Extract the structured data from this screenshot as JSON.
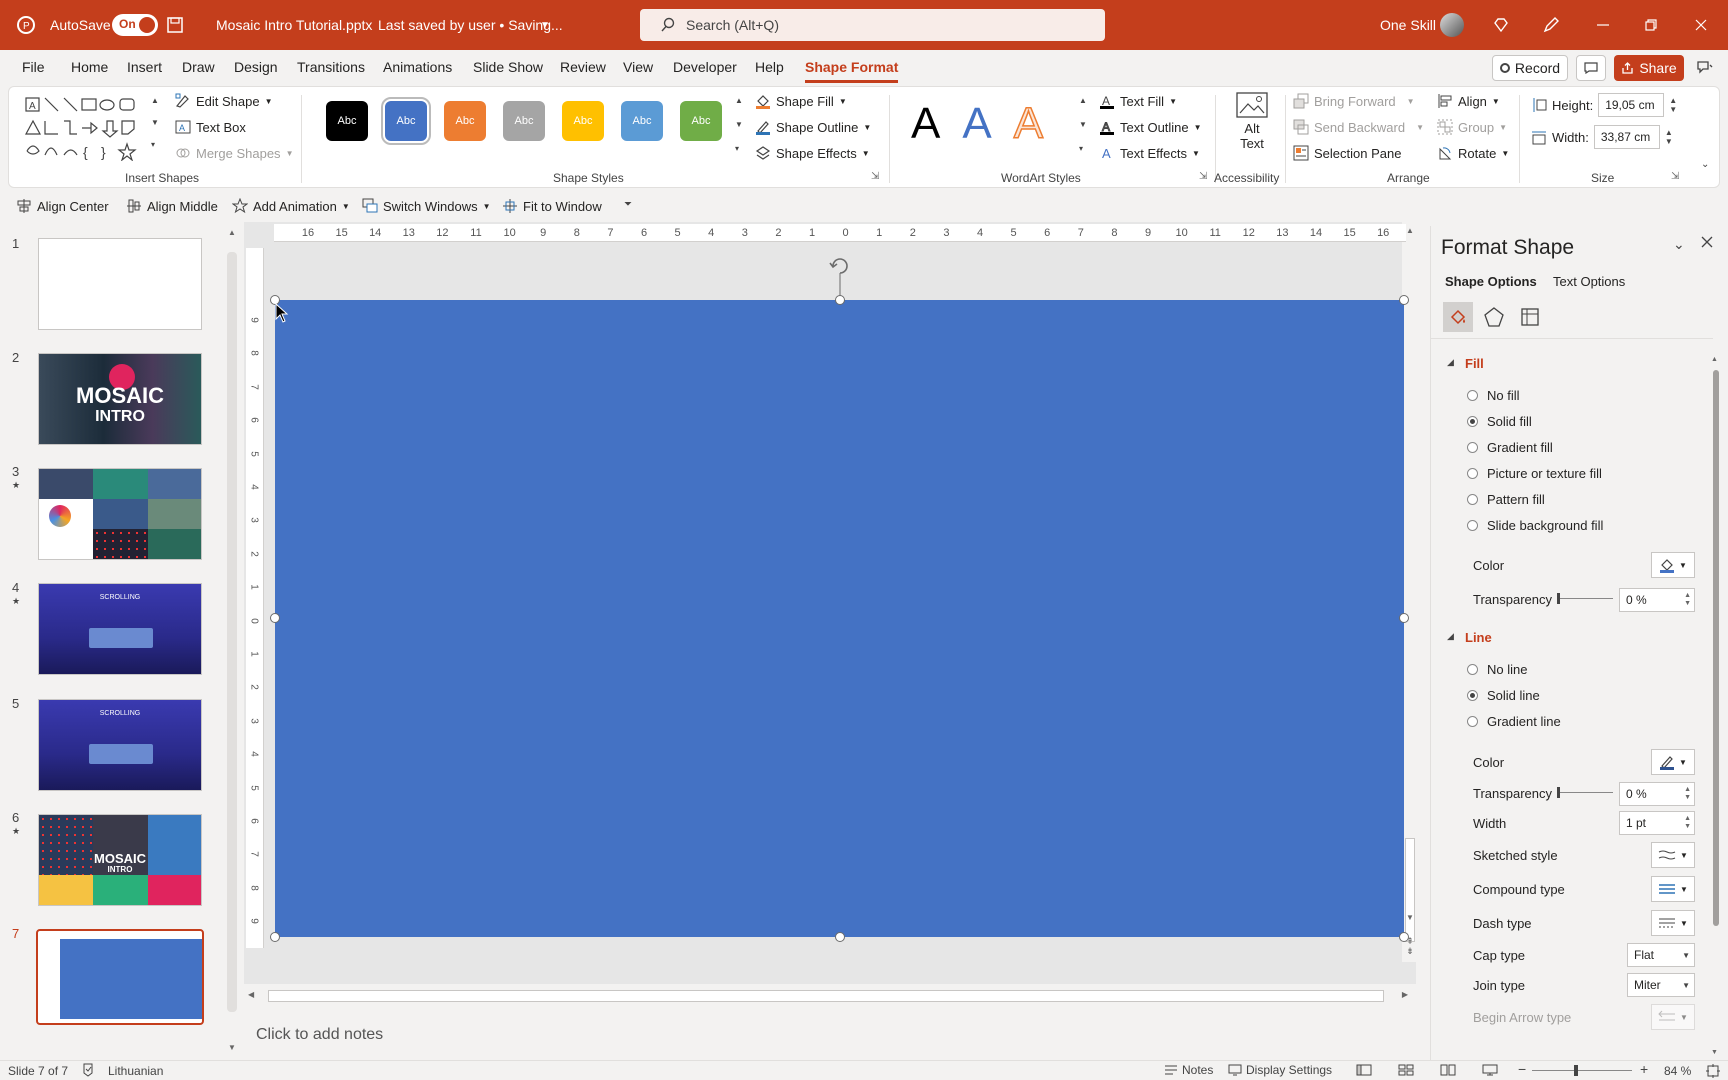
{
  "titlebar": {
    "autosave_label": "AutoSave",
    "autosave_state": "On",
    "doc_title": "Mosaic Intro Tutorial.pptx",
    "save_status": "Last saved by user • Saving...",
    "search_placeholder": "Search (Alt+Q)",
    "user_name": "One Skill"
  },
  "tabs": [
    "File",
    "Home",
    "Insert",
    "Draw",
    "Design",
    "Transitions",
    "Animations",
    "Slide Show",
    "Review",
    "View",
    "Developer",
    "Help",
    "Shape Format"
  ],
  "right_buttons": {
    "record": "Record",
    "share": "Share"
  },
  "ribbon": {
    "insert_shapes": {
      "label": "Insert Shapes",
      "edit_shape": "Edit Shape",
      "text_box": "Text Box",
      "merge_shapes": "Merge Shapes"
    },
    "shape_styles": {
      "label": "Shape Styles",
      "swatch_text": "Abc",
      "fill": "Shape Fill",
      "outline": "Shape Outline",
      "effects": "Shape Effects",
      "swatches": [
        "#000000",
        "#4472c4",
        "#ed7d31",
        "#a5a5a5",
        "#ffc000",
        "#5b9bd5",
        "#70ad47"
      ]
    },
    "wordart": {
      "label": "WordArt Styles",
      "letter": "A",
      "text_fill": "Text Fill",
      "text_outline": "Text Outline",
      "text_effects": "Text Effects"
    },
    "accessibility": {
      "label": "Accessibility",
      "alt_text_1": "Alt",
      "alt_text_2": "Text"
    },
    "arrange": {
      "label": "Arrange",
      "bring_forward": "Bring Forward",
      "send_backward": "Send Backward",
      "selection_pane": "Selection Pane",
      "align": "Align",
      "group": "Group",
      "rotate": "Rotate"
    },
    "size": {
      "label": "Size",
      "height_label": "Height:",
      "height_value": "19,05 cm",
      "width_label": "Width:",
      "width_value": "33,87 cm"
    }
  },
  "qat": {
    "align_center": "Align Center",
    "align_middle": "Align Middle",
    "add_animation": "Add Animation",
    "switch_windows": "Switch Windows",
    "fit_to_window": "Fit to Window"
  },
  "slides": [
    {
      "num": "1",
      "star": ""
    },
    {
      "num": "2",
      "star": "",
      "title": "MOSAIC",
      "subtitle": "INTRO"
    },
    {
      "num": "3",
      "star": "★"
    },
    {
      "num": "4",
      "star": "★",
      "title": "SCROLLING"
    },
    {
      "num": "5",
      "star": "",
      "title": "SCROLLING"
    },
    {
      "num": "6",
      "star": "★",
      "title": "MOSAIC",
      "subtitle": "INTRO"
    },
    {
      "num": "7",
      "star": ""
    }
  ],
  "ruler": {
    "h_ticks": [
      "16",
      "15",
      "14",
      "13",
      "12",
      "11",
      "10",
      "9",
      "8",
      "7",
      "6",
      "5",
      "4",
      "3",
      "2",
      "1",
      "0",
      "1",
      "2",
      "3",
      "4",
      "5",
      "6",
      "7",
      "8",
      "9",
      "10",
      "11",
      "12",
      "13",
      "14",
      "15",
      "16"
    ],
    "v_ticks": [
      "9",
      "8",
      "7",
      "6",
      "5",
      "4",
      "3",
      "2",
      "1",
      "0",
      "1",
      "2",
      "3",
      "4",
      "5",
      "6",
      "7",
      "8",
      "9"
    ]
  },
  "shape": {
    "fill_color": "#4472c4"
  },
  "notes_placeholder": "Click to add notes",
  "format_pane": {
    "title": "Format Shape",
    "tab_shape": "Shape Options",
    "tab_text": "Text Options",
    "fill_section": "Fill",
    "fill_options": [
      "No fill",
      "Solid fill",
      "Gradient fill",
      "Picture or texture fill",
      "Pattern fill",
      "Slide background fill"
    ],
    "fill_selected": 1,
    "color_label": "Color",
    "transparency_label": "Transparency",
    "fill_transparency": "0 %",
    "line_section": "Line",
    "line_options": [
      "No line",
      "Solid line",
      "Gradient line"
    ],
    "line_selected": 1,
    "line_transparency": "0 %",
    "width_label": "Width",
    "width_value": "1 pt",
    "sketched_label": "Sketched style",
    "compound_label": "Compound type",
    "dash_label": "Dash type",
    "cap_label": "Cap type",
    "cap_value": "Flat",
    "join_label": "Join type",
    "join_value": "Miter",
    "begin_arrow_label": "Begin Arrow type"
  },
  "status": {
    "slide_info": "Slide 7 of 7",
    "language": "Lithuanian",
    "notes": "Notes",
    "display_settings": "Display Settings",
    "zoom": "84 %"
  }
}
